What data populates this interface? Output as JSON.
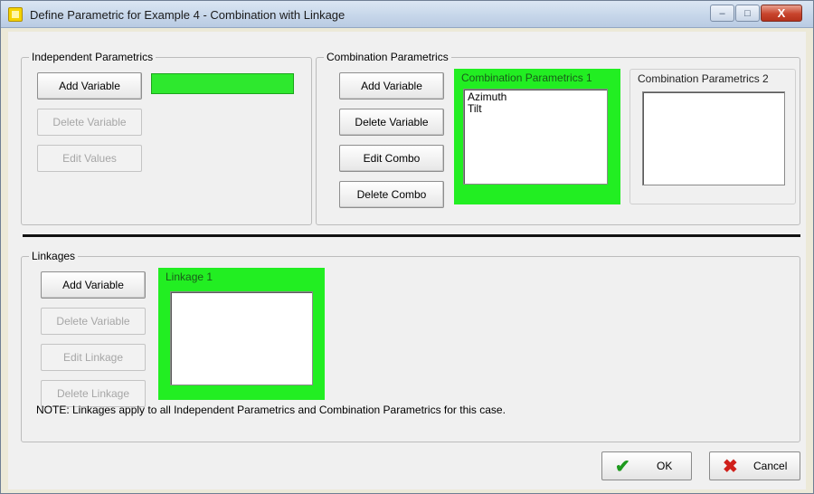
{
  "window": {
    "title": "Define Parametric for Example 4 - Combination with Linkage",
    "min_glyph": "–",
    "max_glyph": "□",
    "close_glyph": "X"
  },
  "independent": {
    "group_label": "Independent Parametrics",
    "add_label": "Add Variable",
    "delete_label": "Delete Variable",
    "edit_label": "Edit Values",
    "field_value": ""
  },
  "combination": {
    "group_label": "Combination Parametrics",
    "add_label": "Add Variable",
    "delete_label": "Delete Variable",
    "edit_combo_label": "Edit Combo",
    "delete_combo_label": "Delete Combo",
    "panel1_title": "Combination Parametrics 1",
    "panel1_items": [
      "Azimuth",
      "Tilt"
    ],
    "panel2_title": "Combination Parametrics 2"
  },
  "linkages": {
    "group_label": "Linkages",
    "add_label": "Add Variable",
    "delete_label": "Delete Variable",
    "edit_label": "Edit Linkage",
    "delete_linkage_label": "Delete Linkage",
    "panel_title": "Linkage 1",
    "note": "NOTE: Linkages apply to all Independent Parametrics and Combination Parametrics for this case."
  },
  "footer": {
    "ok_label": "OK",
    "cancel_label": "Cancel",
    "ok_icon": "check-icon",
    "cancel_icon": "x-icon"
  },
  "colors": {
    "highlight_green": "#22ee22",
    "ok_green": "#1e9a1e",
    "cancel_red": "#d0201b"
  }
}
